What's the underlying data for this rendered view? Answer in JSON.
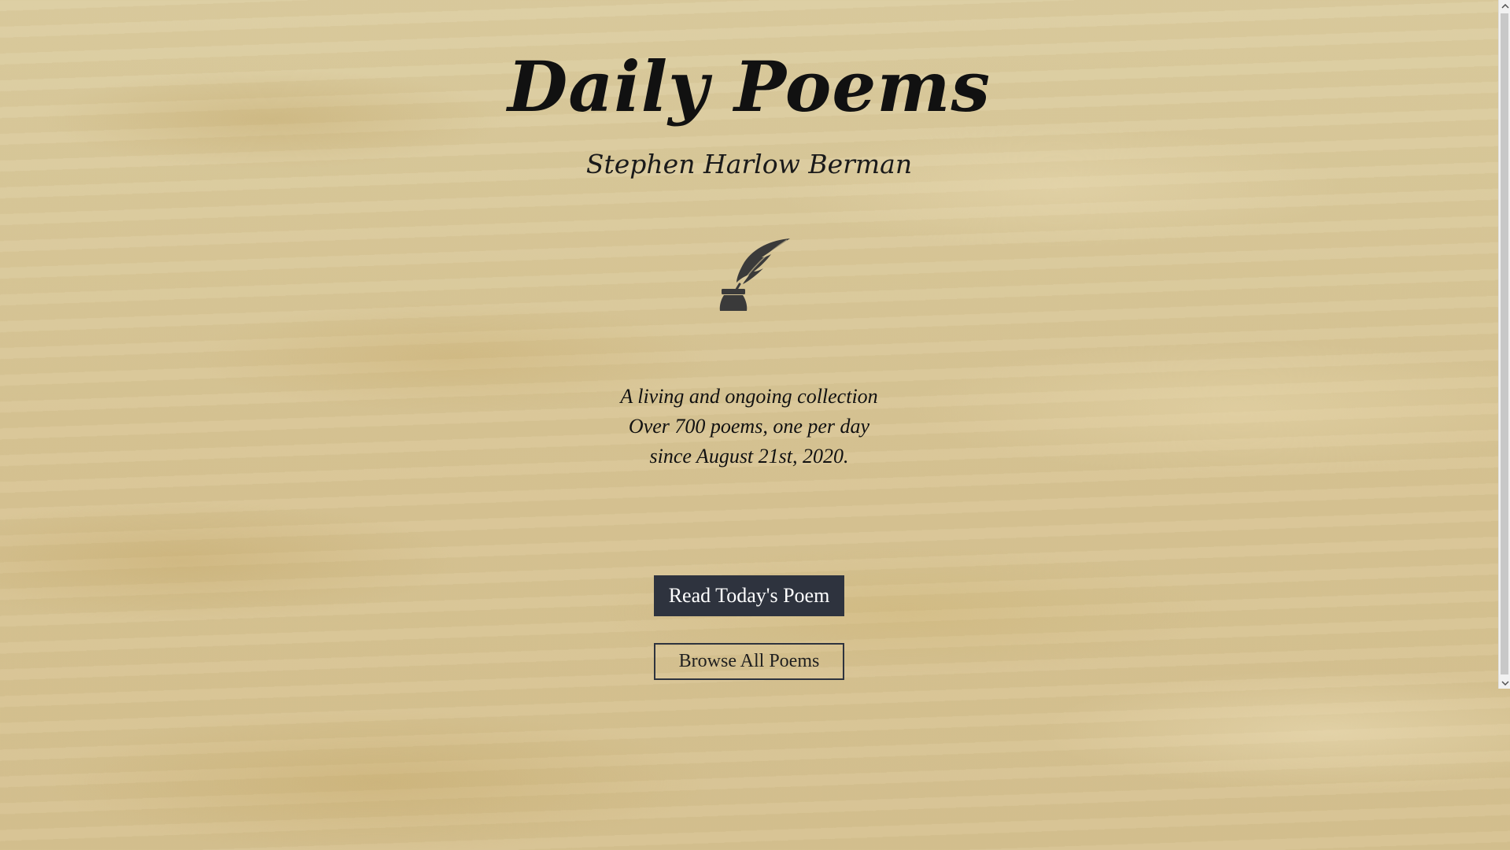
{
  "header": {
    "title": "Daily Poems",
    "author": "Stephen Harlow Berman"
  },
  "logo": {
    "icon": "quill-inkwell-icon",
    "color": "#3a3a3a"
  },
  "tagline": {
    "lines": [
      "A living and ongoing collection",
      "Over 700 poems, one per day",
      "since August 21st, 2020."
    ]
  },
  "actions": {
    "read_today_label": "Read Today's Poem",
    "browse_all_label": "Browse All Poems"
  },
  "colors": {
    "background": "#dccb9c",
    "button_dark": "#2e333e",
    "text": "#111111"
  },
  "scrollbar": {
    "up_icon": "chevron-up-icon",
    "down_icon": "chevron-down-icon"
  }
}
